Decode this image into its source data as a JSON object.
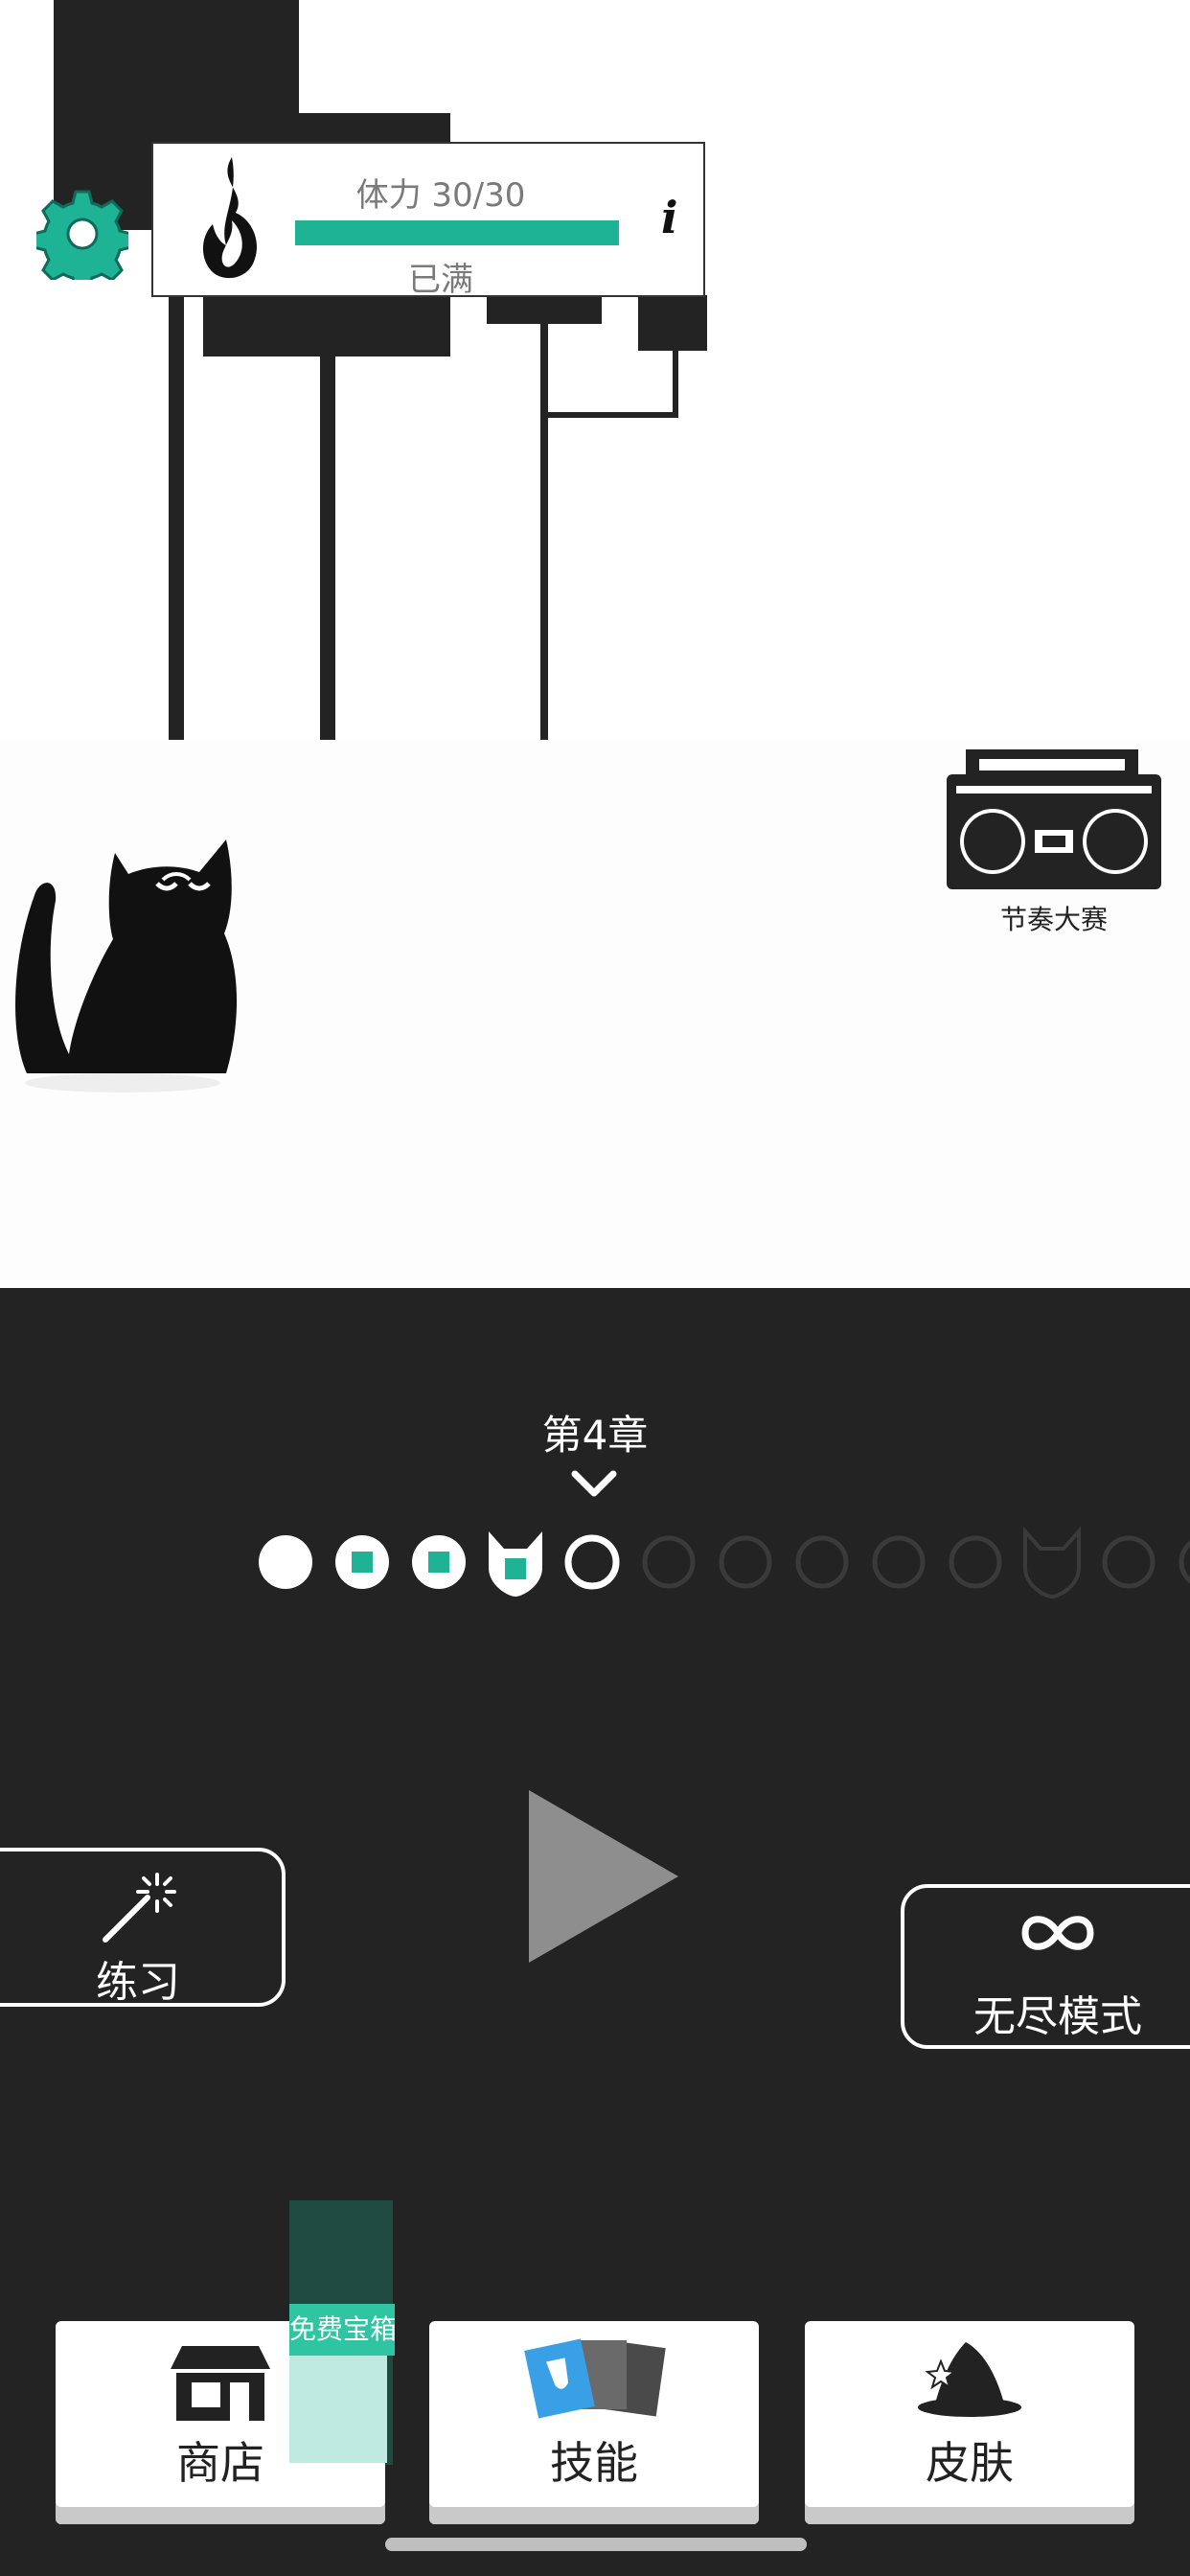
{
  "stamina": {
    "label": "体力 30/30",
    "status": "已满",
    "value": 30,
    "max": 30,
    "fill_fraction": 1.0,
    "bar_color": "#1fb396",
    "info_icon": "info-icon",
    "flame_icon": "flame-icon"
  },
  "settings": {
    "icon": "gear-icon",
    "color": "#1fb396"
  },
  "radio_contest": {
    "label": "节奏大赛",
    "icon": "boombox-icon"
  },
  "chapter": {
    "label": "第4章",
    "current_index": 4,
    "levels": [
      {
        "state": "completed"
      },
      {
        "state": "completed-gem"
      },
      {
        "state": "completed-gem"
      },
      {
        "state": "boss-completed-gem"
      },
      {
        "state": "current"
      },
      {
        "state": "locked"
      },
      {
        "state": "locked"
      },
      {
        "state": "locked"
      },
      {
        "state": "locked"
      },
      {
        "state": "locked"
      },
      {
        "state": "boss-locked"
      },
      {
        "state": "locked"
      },
      {
        "state": "locked"
      }
    ]
  },
  "practice": {
    "label": "练习",
    "icon": "magic-wand-icon"
  },
  "endless": {
    "label": "无尽模式",
    "icon": "infinity-icon"
  },
  "play": {
    "icon": "play-icon"
  },
  "free_chest": {
    "label": "免费宝箱"
  },
  "bottom_nav": {
    "shop": {
      "label": "商店",
      "icon": "shop-icon"
    },
    "skills": {
      "label": "技能",
      "icon": "skill-cards-icon"
    },
    "skins": {
      "label": "皮肤",
      "icon": "wizard-hat-icon"
    }
  },
  "colors": {
    "accent": "#1fb396",
    "dark_bg": "#232323"
  }
}
